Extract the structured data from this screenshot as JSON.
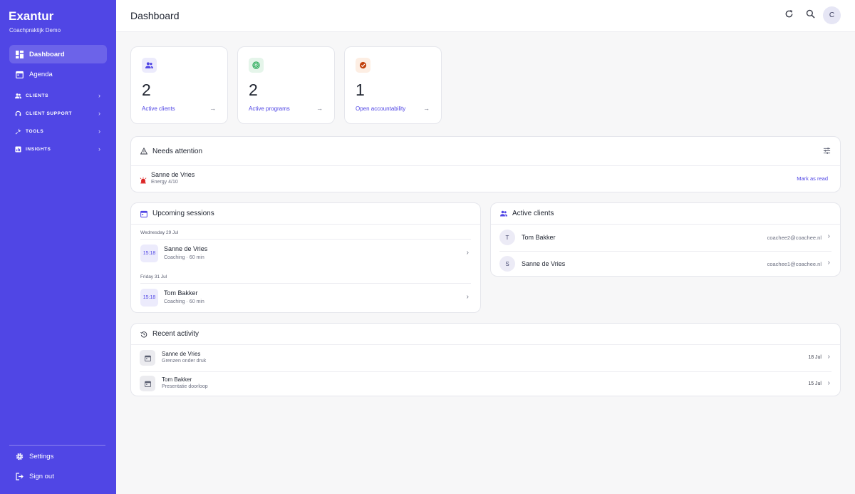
{
  "app": {
    "brand": "Exantur",
    "org": "Coachpraktijk Demo"
  },
  "sidebar": {
    "items": [
      {
        "label": "Dashboard",
        "icon": "dashboard-icon",
        "active": true
      },
      {
        "label": "Agenda",
        "icon": "calendar-icon",
        "active": false
      }
    ],
    "groups": [
      {
        "label": "CLIENTS",
        "icon": "people-icon"
      },
      {
        "label": "CLIENT SUPPORT",
        "icon": "support-icon"
      },
      {
        "label": "TOOLS",
        "icon": "wrench-icon"
      },
      {
        "label": "INSIGHTS",
        "icon": "chart-icon"
      }
    ],
    "footer": [
      {
        "label": "Settings",
        "icon": "gear-icon"
      },
      {
        "label": "Sign out",
        "icon": "logout-icon"
      }
    ]
  },
  "header": {
    "title": "Dashboard",
    "avatar_initial": "C"
  },
  "stats": [
    {
      "value": "2",
      "label": "Active clients",
      "icon": "people-icon",
      "color": "#5046e5",
      "bg": "#ecebfc"
    },
    {
      "value": "2",
      "label": "Active programs",
      "icon": "target-icon",
      "color": "#16a34a",
      "bg": "#e5f5ea"
    },
    {
      "value": "1",
      "label": "Open accountability",
      "icon": "check-circle-icon",
      "color": "#c2410c",
      "bg": "#fdeee3"
    }
  ],
  "attention": {
    "title": "Needs attention",
    "items": [
      {
        "name": "Sanne de Vries",
        "detail": "Energy 4/10",
        "action": "Mark as read"
      }
    ]
  },
  "sessions": {
    "title": "Upcoming sessions",
    "groups": [
      {
        "date": "Wednesday 29 Jul",
        "time": "15:18",
        "name": "Sanne de Vries",
        "detail": "Coaching · 60 min"
      },
      {
        "date": "Friday 31 Jul",
        "time": "15:18",
        "name": "Tom Bakker",
        "detail": "Coaching · 60 min"
      }
    ]
  },
  "clients": {
    "title": "Active clients",
    "items": [
      {
        "initial": "T",
        "name": "Tom Bakker",
        "email": "coachee2@coachee.nl"
      },
      {
        "initial": "S",
        "name": "Sanne de Vries",
        "email": "coachee1@coachee.nl"
      }
    ]
  },
  "activity": {
    "title": "Recent activity",
    "items": [
      {
        "name": "Sanne de Vries",
        "detail": "Grenzen onder druk",
        "date": "18 Jul"
      },
      {
        "name": "Tom Bakker",
        "detail": "Presentatie doorloop",
        "date": "15 Jul"
      }
    ]
  },
  "colors": {
    "accent": "#5046e5",
    "alert": "#dc2626"
  }
}
